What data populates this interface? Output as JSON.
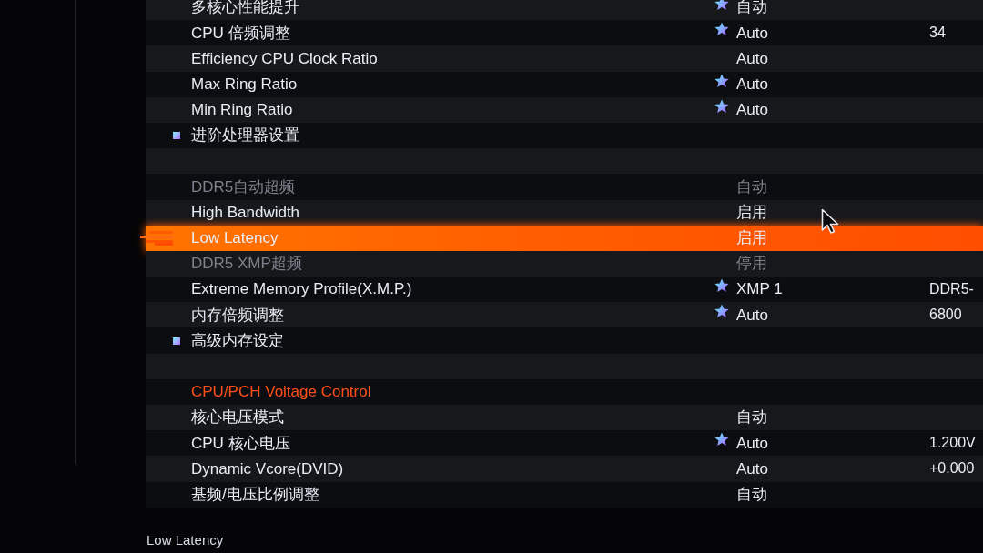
{
  "settings": [
    {
      "kind": "option",
      "label": "多核心性能提升",
      "value": "自动",
      "starred": true,
      "disabled": false,
      "selected": false
    },
    {
      "kind": "option",
      "label": "CPU 倍频调整",
      "value": "Auto",
      "reading": "34",
      "starred": true,
      "disabled": false,
      "selected": false
    },
    {
      "kind": "option",
      "label": "Efficiency CPU Clock Ratio",
      "value": "Auto",
      "starred": false,
      "disabled": false,
      "selected": false
    },
    {
      "kind": "option",
      "label": "Max Ring Ratio",
      "value": "Auto",
      "starred": true,
      "disabled": false,
      "selected": false
    },
    {
      "kind": "option",
      "label": "Min Ring Ratio",
      "value": "Auto",
      "starred": true,
      "disabled": false,
      "selected": false
    },
    {
      "kind": "submenu",
      "label": "进阶处理器设置",
      "selected": false
    },
    {
      "kind": "blank",
      "selected": false
    },
    {
      "kind": "option",
      "label": "DDR5自动超频",
      "value": "自动",
      "starred": false,
      "disabled": true,
      "selected": false
    },
    {
      "kind": "option",
      "label": "High Bandwidth",
      "value": "启用",
      "starred": false,
      "disabled": false,
      "selected": false
    },
    {
      "kind": "option",
      "label": "Low Latency",
      "value": "启用",
      "starred": false,
      "disabled": false,
      "selected": true
    },
    {
      "kind": "option",
      "label": "DDR5 XMP超频",
      "value": "停用",
      "starred": false,
      "disabled": true,
      "selected": false
    },
    {
      "kind": "option",
      "label": "Extreme Memory Profile(X.M.P.)",
      "value": "XMP 1",
      "reading": "DDR5-",
      "starred": true,
      "disabled": false,
      "selected": false
    },
    {
      "kind": "option",
      "label": "内存倍频调整",
      "value": "Auto",
      "reading": "6800",
      "starred": true,
      "disabled": false,
      "selected": false
    },
    {
      "kind": "submenu",
      "label": "高级内存设定",
      "selected": false
    },
    {
      "kind": "blank",
      "selected": false
    },
    {
      "kind": "heading",
      "label": "CPU/PCH Voltage Control",
      "selected": false
    },
    {
      "kind": "option",
      "label": "核心电压模式",
      "value": "自动",
      "starred": false,
      "disabled": false,
      "selected": false
    },
    {
      "kind": "option",
      "label": "CPU 核心电压",
      "value": "Auto",
      "reading": "1.200V",
      "starred": true,
      "disabled": false,
      "selected": false
    },
    {
      "kind": "option",
      "label": "Dynamic Vcore(DVID)",
      "value": "Auto",
      "reading": "+0.000",
      "starred": false,
      "disabled": false,
      "selected": false
    },
    {
      "kind": "option",
      "label": "基频/电压比例调整",
      "value": "自动",
      "starred": false,
      "disabled": false,
      "selected": false
    }
  ],
  "help_text": "Low Latency"
}
